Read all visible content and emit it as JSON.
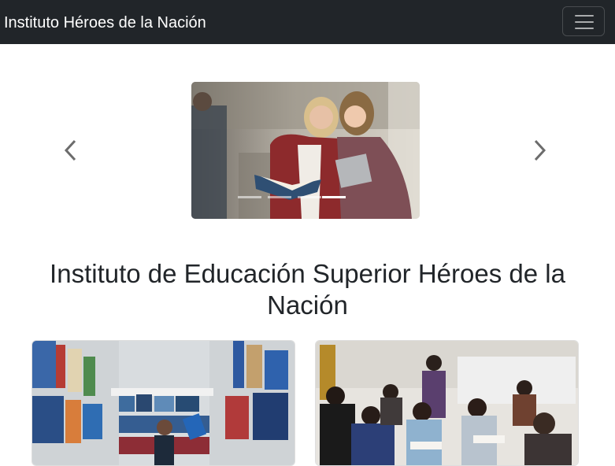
{
  "navbar": {
    "brand": "Instituto Héroes de la Nación",
    "toggler_icon": "hamburger-menu-icon"
  },
  "carousel": {
    "slides": [
      {
        "image": "students-laughing-with-books-photo",
        "active": true
      }
    ],
    "indicator_count": 4,
    "active_indicator": 3,
    "prev_icon": "chevron-left-icon",
    "next_icon": "chevron-right-icon"
  },
  "main": {
    "title": "Instituto de Educación Superior Héroes de la Nación"
  },
  "cards": [
    {
      "image": "library-bookshelves-photo"
    },
    {
      "image": "students-in-classroom-photo"
    }
  ]
}
